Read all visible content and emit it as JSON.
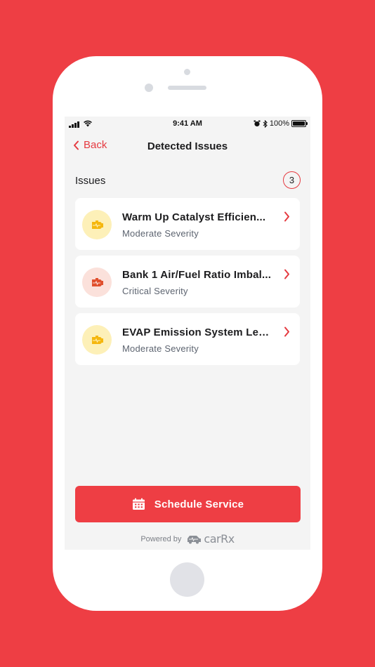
{
  "status_bar": {
    "time": "9:41 AM",
    "battery_percent": "100%"
  },
  "nav": {
    "back_label": "Back",
    "title": "Detected Issues"
  },
  "issues_section": {
    "label": "Issues",
    "count": "3"
  },
  "issues": [
    {
      "title": "Warm Up Catalyst Efficien...",
      "severity": "Moderate Severity",
      "icon": "engine-warning-icon",
      "icon_bg": "#fdf0b8",
      "icon_color": "#f5b70f"
    },
    {
      "title": "Bank 1 Air/Fuel Ratio Imbal...",
      "severity": "Critical Severity",
      "icon": "engine-warning-icon",
      "icon_bg": "#fbe1db",
      "icon_color": "#e0502e"
    },
    {
      "title": "EVAP Emission System Lea...",
      "severity": "Moderate Severity",
      "icon": "engine-warning-icon",
      "icon_bg": "#fdf0b8",
      "icon_color": "#f5b70f"
    }
  ],
  "schedule_button": {
    "label": "Schedule Service"
  },
  "footer": {
    "powered_by": "Powered by",
    "brand": "carRx"
  },
  "colors": {
    "accent": "#ee3e44",
    "background": "#f4f4f4"
  }
}
